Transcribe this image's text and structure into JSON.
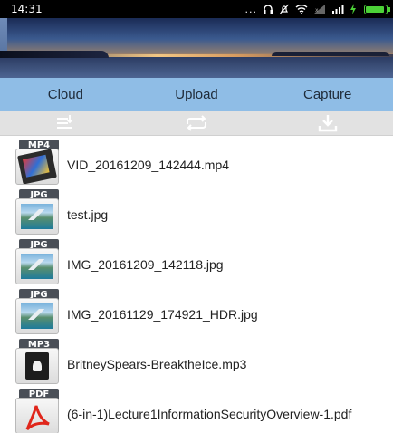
{
  "status_bar": {
    "time": "14:31",
    "dots": "...",
    "colors": {
      "battery": "#4cd137"
    }
  },
  "tabs": [
    {
      "label": "Cloud"
    },
    {
      "label": "Upload"
    },
    {
      "label": "Capture"
    }
  ],
  "toolbar": {
    "icons": [
      "list-add-icon",
      "repeat-icon",
      "download-icon"
    ]
  },
  "files": [
    {
      "type": "MP4",
      "name": "VID_20161209_142444.mp4",
      "icon": "video-file-icon"
    },
    {
      "type": "JPG",
      "name": "test.jpg",
      "icon": "image-file-icon"
    },
    {
      "type": "JPG",
      "name": "IMG_20161209_142118.jpg",
      "icon": "image-file-icon"
    },
    {
      "type": "JPG",
      "name": "IMG_20161129_174921_HDR.jpg",
      "icon": "image-file-icon"
    },
    {
      "type": "MP3",
      "name": "BritneySpears-BreaktheIce.mp3",
      "icon": "audio-file-icon"
    },
    {
      "type": "PDF",
      "name": "(6-in-1)Lecture1InformationSecurityOverview-1.pdf",
      "icon": "pdf-file-icon"
    }
  ],
  "colors": {
    "tab_bar": "#8fbde6",
    "toolbar": "#e2e2e2",
    "toolbar_icon": "#ffffff"
  }
}
